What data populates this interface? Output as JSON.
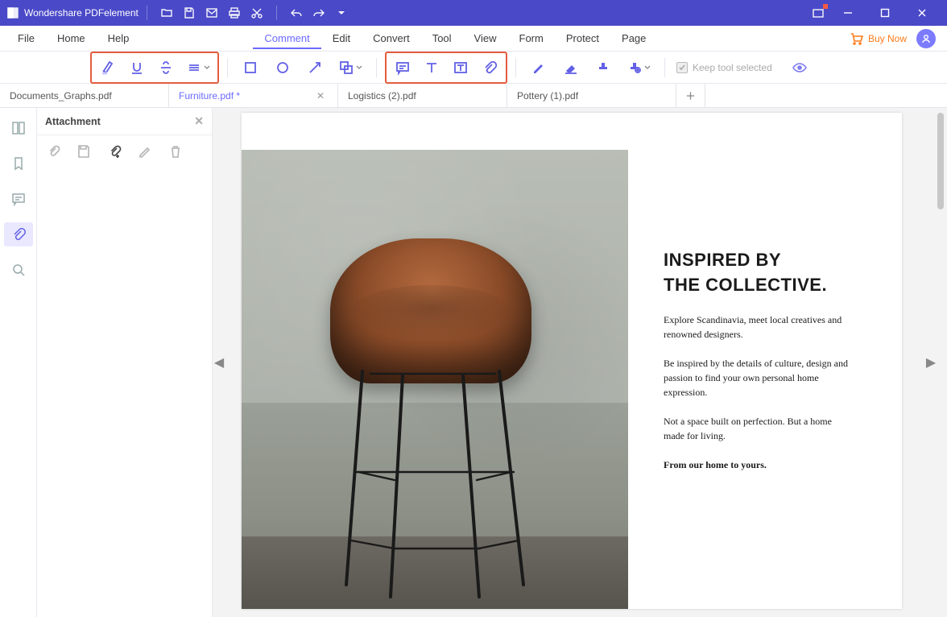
{
  "app": {
    "title": "Wondershare PDFelement",
    "buy": "Buy Now"
  },
  "menubar": {
    "items": [
      "File",
      "Home",
      "Help",
      "Comment",
      "Edit",
      "Convert",
      "Tool",
      "View",
      "Form",
      "Protect",
      "Page"
    ],
    "active": "Comment"
  },
  "toolbar": {
    "keep_tool_label": "Keep tool selected",
    "keep_tool_checked": true
  },
  "tabs": {
    "items": [
      {
        "label": "Documents_Graphs.pdf",
        "active": false,
        "closeable": false
      },
      {
        "label": "Furniture.pdf *",
        "active": true,
        "closeable": true
      },
      {
        "label": "Logistics (2).pdf",
        "active": false,
        "closeable": false
      },
      {
        "label": "Pottery (1).pdf",
        "active": false,
        "closeable": false
      }
    ]
  },
  "sidepanel": {
    "title": "Attachment"
  },
  "document": {
    "heading_l1": "INSPIRED BY",
    "heading_l2": "THE COLLECTIVE.",
    "p1": "Explore Scandinavia, meet local creatives and renowned designers.",
    "p2": "Be inspired by the details of culture, design and passion to find your own personal home expression.",
    "p3": "Not a space built on perfection. But a home made for living.",
    "p4": "From our home to yours."
  }
}
